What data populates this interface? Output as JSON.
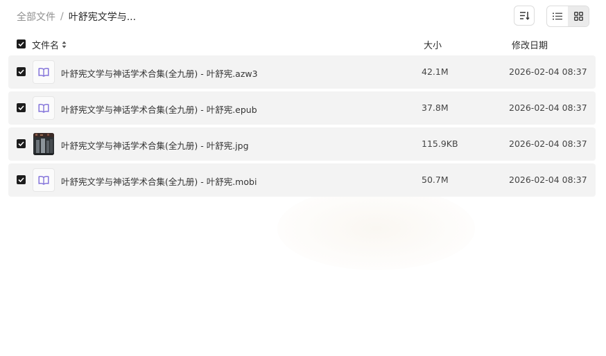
{
  "breadcrumb": {
    "root": "全部文件",
    "separator": "/",
    "current": "叶舒宪文学与..."
  },
  "toolbar": {
    "sort_icon": "sort-lines-icon",
    "list_view_icon": "list-view-icon",
    "grid_view_icon": "grid-view-icon",
    "active_view": "grid"
  },
  "columns": {
    "name": "文件名",
    "size": "大小",
    "modified": "修改日期"
  },
  "files": [
    {
      "name": "叶舒宪文学与神话学术合集(全九册) - 叶舒宪.azw3",
      "size": "42.1M",
      "modified": "2026-02-04 08:37",
      "icon": "ebook-icon",
      "checked": true
    },
    {
      "name": "叶舒宪文学与神话学术合集(全九册) - 叶舒宪.epub",
      "size": "37.8M",
      "modified": "2026-02-04 08:37",
      "icon": "ebook-icon",
      "checked": true
    },
    {
      "name": "叶舒宪文学与神话学术合集(全九册) - 叶舒宪.jpg",
      "size": "115.9KB",
      "modified": "2026-02-04 08:37",
      "icon": "image-thumbnail",
      "checked": true
    },
    {
      "name": "叶舒宪文学与神话学术合集(全九册) - 叶舒宪.mobi",
      "size": "50.7M",
      "modified": "2026-02-04 08:37",
      "icon": "ebook-icon",
      "checked": true
    }
  ],
  "colors": {
    "checkbox": "#1c1c1c",
    "row_background": "#f3f3f3",
    "ebook_icon": "#7b6ad8"
  }
}
